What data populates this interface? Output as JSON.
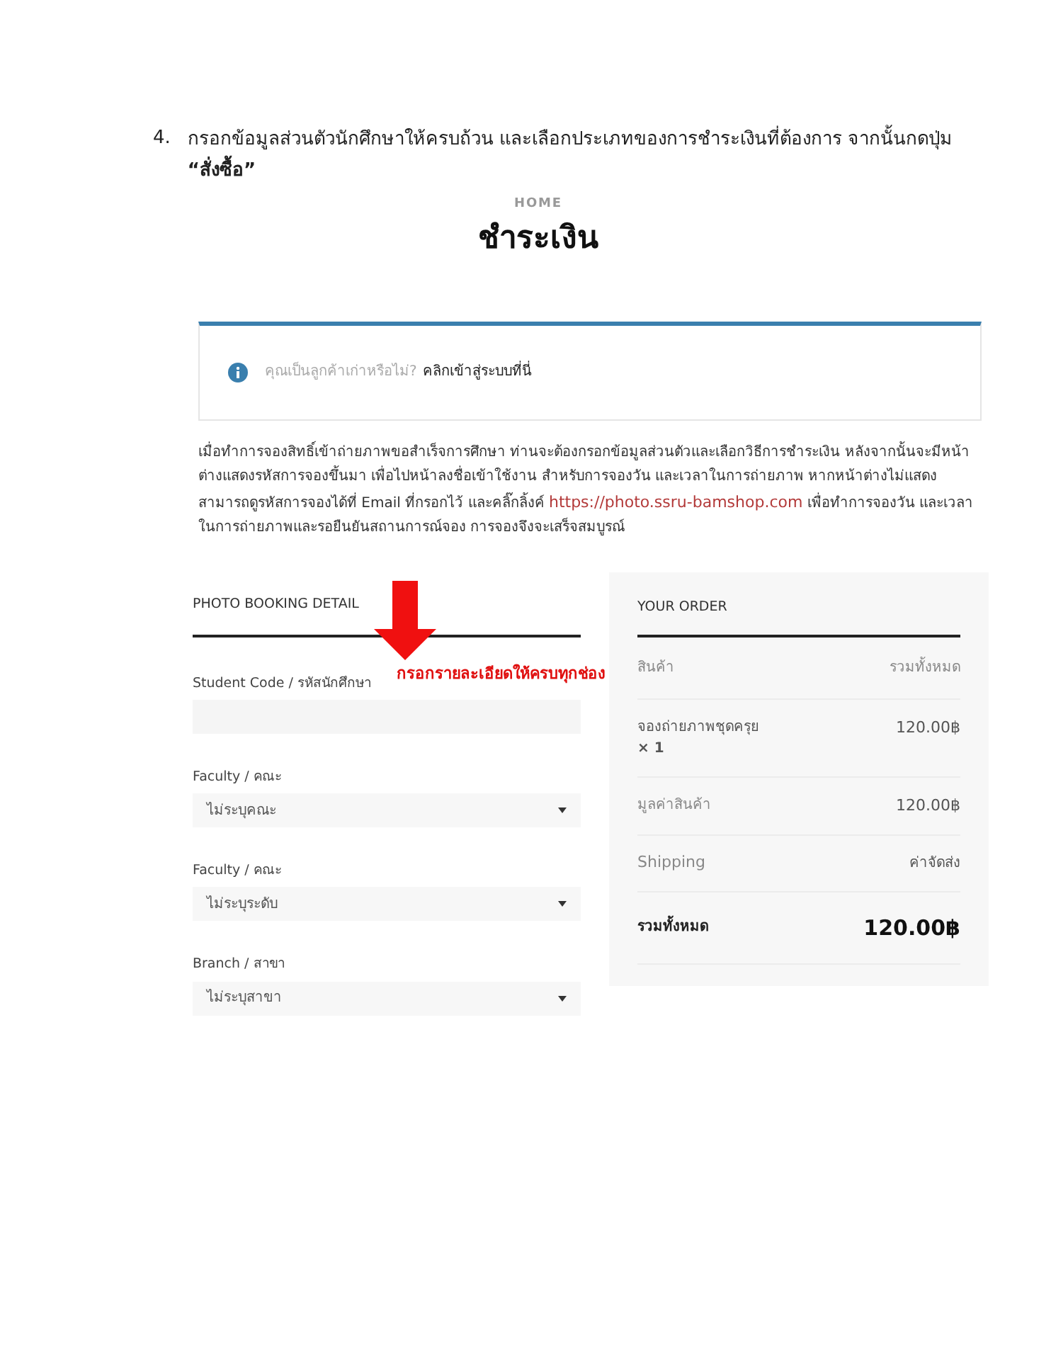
{
  "step": {
    "number": "4.",
    "text": "กรอกข้อมูลส่วนตัวนักศึกษาให้ครบถ้วน และเลือกประเภทของการชำระเงินที่ต้องการ จากนั้นกดปุ่ม",
    "emphasis": "“สั่งซื้อ”"
  },
  "page": {
    "breadcrumb": "HOME",
    "title": "ชำระเงิน"
  },
  "notice": {
    "text": "คุณเป็นลูกค้าเก่าหรือไม่?",
    "link": "คลิกเข้าสู่ระบบที่นี่"
  },
  "intro": {
    "before": "เมื่อทำการจองสิทธิ์เข้าถ่ายภาพขอสำเร็จการศึกษา ท่านจะต้องกรอกข้อมูลส่วนตัวและเลือกวิธีการชำระเงิน หลังจากนั้นจะมีหน้าต่างแสดงรหัสการจองขึ้นมา เพื่อไปหน้าลงชื่อเข้าใช้งาน สำหรับการจองวัน และเวลาในการถ่ายภาพ หากหน้าต่างไม่แสดง สามารถดูรหัสการจองได้ที่ Email ที่กรอกไว้ และคลิ๊กลิ้งค์",
    "link": "https://photo.ssru-bamshop.com",
    "after": "เพื่อทำการจองวัน และเวลาในการถ่ายภาพและรอยืนยันสถานการณ์จอง การจองจึงจะเสร็จสมบูรณ์"
  },
  "booking": {
    "heading": "PHOTO BOOKING DETAIL",
    "fields": [
      {
        "kind": "text",
        "label": "Student Code / รหัสนักศึกษา"
      },
      {
        "kind": "select",
        "label": "Faculty / คณะ",
        "value": "ไม่ระบุคณะ"
      },
      {
        "kind": "select",
        "label": "Faculty / คณะ",
        "value": "ไม่ระบุระดับ"
      },
      {
        "kind": "select",
        "label": "Branch / สาขา",
        "value": "ไม่ระบุสาขา"
      }
    ]
  },
  "annotation": {
    "text": "กรอกรายละเอียดให้ครบทุกช่อง"
  },
  "order": {
    "heading": "YOUR ORDER",
    "columns": [
      "สินค้า",
      "รวมทั้งหมด"
    ],
    "items": [
      {
        "name": "จองถ่ายภาพชุดครุย",
        "quantity": "× 1",
        "price": "120.00฿"
      }
    ],
    "subtotal": {
      "label": "มูลค่าสินค้า",
      "value": "120.00฿"
    },
    "shipping": {
      "label": "Shipping",
      "value": "ค่าจัดส่ง"
    },
    "total": {
      "label": "รวมทั้งหมด",
      "value": "120.00฿"
    }
  }
}
